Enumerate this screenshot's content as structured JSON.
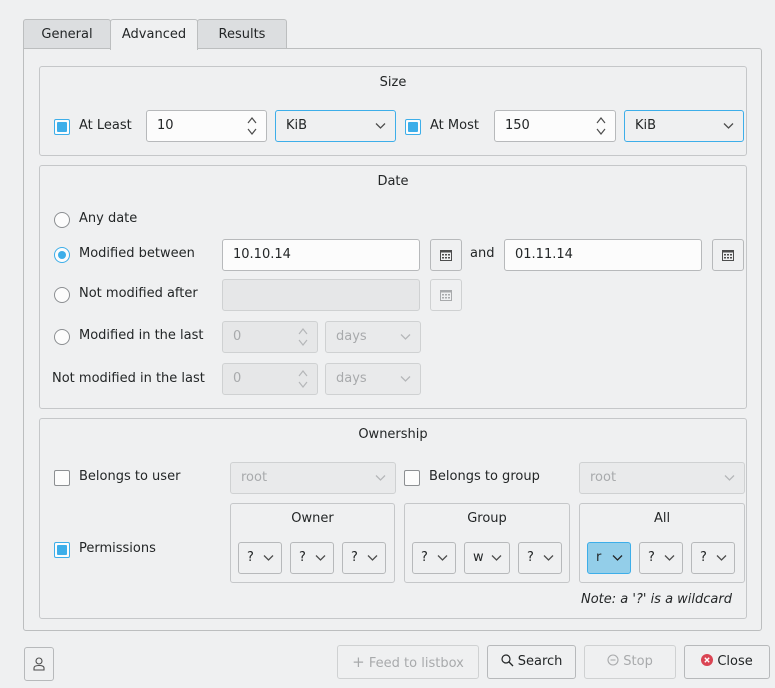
{
  "tabs": [
    "General",
    "Advanced",
    "Results"
  ],
  "size": {
    "title": "Size",
    "at_least_label": "At Least",
    "at_least_value": "10",
    "at_least_unit": "KiB",
    "at_most_label": "At Most",
    "at_most_value": "150",
    "at_most_unit": "KiB"
  },
  "date": {
    "title": "Date",
    "any_date": "Any date",
    "modified_between": "Modified between",
    "from_value": "10.10.14",
    "and_label": "and",
    "to_value": "01.11.14",
    "not_modified_after": "Not modified after",
    "not_modified_after_value": "",
    "modified_in_last": "Modified in the last",
    "modified_in_last_value": "0",
    "modified_in_last_unit": "days",
    "not_modified_in_last": "Not modified in the last",
    "not_modified_in_last_value": "0",
    "not_modified_in_last_unit": "days"
  },
  "ownership": {
    "title": "Ownership",
    "belongs_to_user": "Belongs to user",
    "user_value": "root",
    "belongs_to_group": "Belongs to group",
    "group_value": "root",
    "permissions": "Permissions",
    "owner_title": "Owner",
    "group_title": "Group",
    "all_title": "All",
    "owner_perms": [
      "?",
      "?",
      "?"
    ],
    "group_perms": [
      "?",
      "w",
      "?"
    ],
    "all_perms": [
      "r",
      "?",
      "?"
    ],
    "note": "Note: a '?' is a wildcard"
  },
  "buttons": {
    "feed": "Feed to listbox",
    "search": "Search",
    "stop": "Stop",
    "close": "Close"
  },
  "colors": {
    "accent": "#3daee9",
    "selected_bg": "#93cee9",
    "close_icon": "#da4453"
  }
}
